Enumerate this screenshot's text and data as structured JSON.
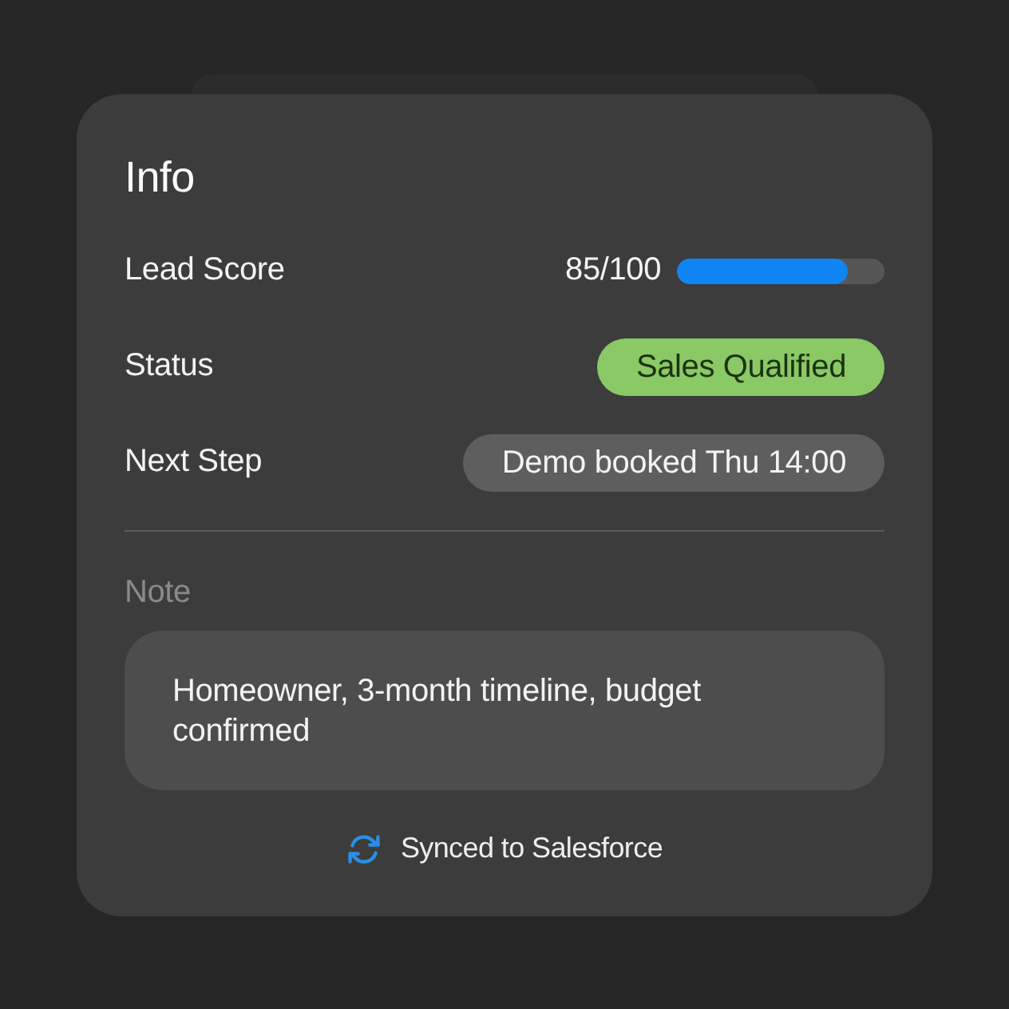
{
  "card": {
    "title": "Info"
  },
  "fields": [
    {
      "kind": "score",
      "label": "Lead Score",
      "reading": "85/100",
      "level": 0.82
    },
    {
      "kind": "status",
      "label": "Status",
      "value": "Sales Qualified",
      "color": "#8bc866"
    },
    {
      "kind": "step",
      "label": "Next Step",
      "value": "Demo booked Thu 14:00",
      "color": "#5e5e5e"
    }
  ],
  "note": {
    "label": "Note",
    "text": "Homeowner, 3-month timeline, budget confirmed"
  },
  "sync": {
    "text": "Synced to Salesforce"
  }
}
